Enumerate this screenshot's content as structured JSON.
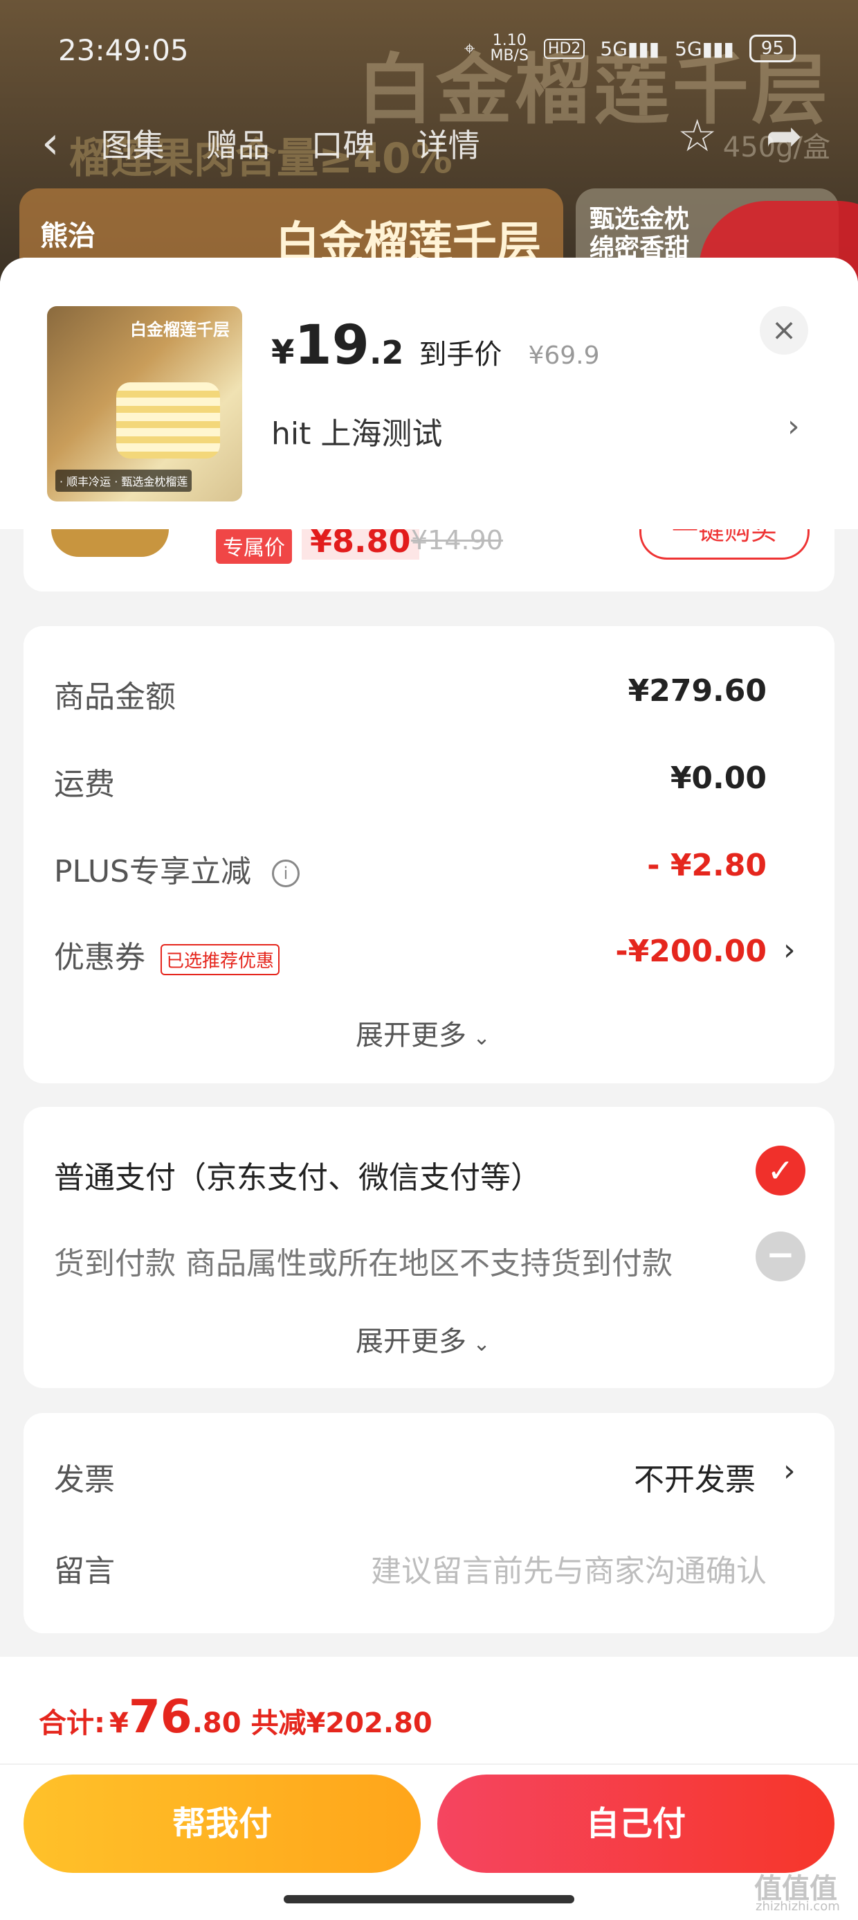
{
  "status_bar": {
    "time": "23:49:05",
    "net_speed": "1.10",
    "net_unit": "MB/S",
    "hd": "HD2",
    "sig1": "5G",
    "sig2": "5G",
    "battery": "95"
  },
  "nav": {
    "tabs": [
      "图集",
      "赠品",
      "口碑",
      "详情"
    ]
  },
  "background": {
    "banner_title": "白金榴莲千层",
    "banner_sub": "榴莲果肉含量≥40%",
    "weight": "450g/盒",
    "brand": "熊治",
    "card2_line1": "甄选金枕",
    "card2_line2": "绵密香甜"
  },
  "product": {
    "thumb_title": "白金榴莲千层",
    "thumb_bottom": "· 顺丰冷运  · 甄选金枕榴莲",
    "currency": "¥",
    "price_int": "19",
    "price_dec": ".2",
    "price_tag": "到手价",
    "original_price": "¥69.9",
    "address": "hit  上海测试"
  },
  "upsell": {
    "exclusive_label": "专属价",
    "price": "¥8.80",
    "original": "¥14.90",
    "button": "一键购买"
  },
  "amounts": {
    "goods_label": "商品金额",
    "goods_value": "¥279.60",
    "shipping_label": "运费",
    "shipping_value": "¥0.00",
    "plus_label": "PLUS专享立减",
    "plus_value": "- ¥2.80",
    "coupon_label": "优惠券",
    "coupon_badge": "已选推荐优惠",
    "coupon_value": "-¥200.00",
    "expand": "展开更多"
  },
  "payment": {
    "normal": "普通支付（京东支付、微信支付等）",
    "cod": "货到付款 商品属性或所在地区不支持货到付款",
    "expand": "展开更多"
  },
  "invoice": {
    "label": "发票",
    "value": "不开发票",
    "note_label": "留言",
    "note_placeholder": "建议留言前先与商家沟通确认"
  },
  "footer": {
    "total_label": "合计:",
    "total_currency": "¥",
    "total_int": "76",
    "total_dec": ".80",
    "saved": "共减¥202.80",
    "help_pay": "帮我付",
    "self_pay": "自己付"
  },
  "watermark": {
    "text": "值值值",
    "url": "zhizhizhi.com"
  },
  "colors": {
    "accent_red": "#e5261d",
    "help_yellow": "#ffb51f",
    "self_red": "#f53d3d"
  }
}
